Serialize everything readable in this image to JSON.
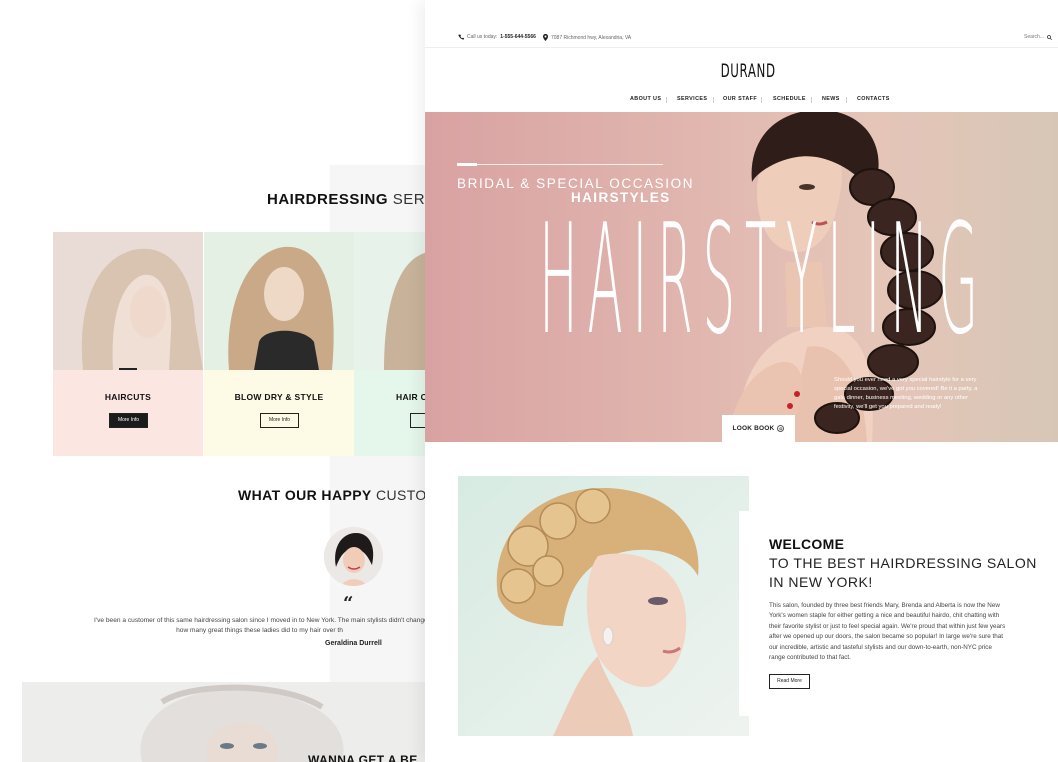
{
  "back_page": {
    "services": {
      "heading_bold": "HAIRDRESSING",
      "heading_light": "SERVIC",
      "cards": [
        {
          "title": "HAIRCUTS",
          "button": "More Info",
          "bg": "#fce6e2"
        },
        {
          "title": "BLOW DRY & STYLE",
          "button": "More Info",
          "bg": "#fdfbe6"
        },
        {
          "title": "HAIR C",
          "button": "Mo",
          "bg": "#e4f7ea"
        }
      ]
    },
    "testimonials": {
      "heading_bold": "WHAT OUR HAPPY",
      "heading_light": "CUSTOM",
      "quote_mark": "“",
      "text_line1": "I've been a customer of this same hairdressing salon since I moved in to New York. The main stylists didn't change",
      "text_line2": "how many great things these ladies did to my hair over th",
      "author": "Geraldina Durrell"
    },
    "cta": {
      "text": "WANNA GET A BE"
    }
  },
  "topbar": {
    "phone_label": "Call us today:",
    "phone_number": "1-555-644-5566",
    "address": "7087 Richmond hwy, Alexandria, VA",
    "search_placeholder": "Search..."
  },
  "brand": {
    "logo": "DURAND"
  },
  "nav": {
    "items": [
      "ABOUT US",
      "SERVICES",
      "OUR STAFF",
      "SCHEDULE",
      "NEWS",
      "CONTACTS"
    ]
  },
  "hero": {
    "subtitle_line1": "BRIDAL & SPECIAL OCCASION",
    "subtitle_line2": "HAIRSTYLES",
    "big_text": "HAIRSTYLING",
    "note": "Should you ever need a very special hairstyle for a very special occasion, we've got you covered! Be it a party, a gala dinner, business meeting, wedding or any other festivity, we'll get you prepared and ready!",
    "button": "LOOK BOOK",
    "button_icon": "⊙"
  },
  "welcome": {
    "title_line1": "WELCOME",
    "title_line2": "TO THE BEST HAIRDRESSING SALON",
    "title_line3": "IN NEW YORK!",
    "body": "This salon, founded by three best friends Mary, Brenda and Alberta is now the New York's women staple for either getting a nice and beautiful hairdo, chit chatting with their favorite stylist or just to feel special again. We're proud that within just few years after we opened up our doors, the salon became so popular! In large we're sure that our incredible, artistic and tasteful stylists and our down-to-earth, non-NYC price range contributed to that fact.",
    "button": "Read More"
  },
  "colors": {
    "hero_pink": "#d9a2a2",
    "hero_beige": "#d7c6b6",
    "text_dark": "#111111"
  }
}
